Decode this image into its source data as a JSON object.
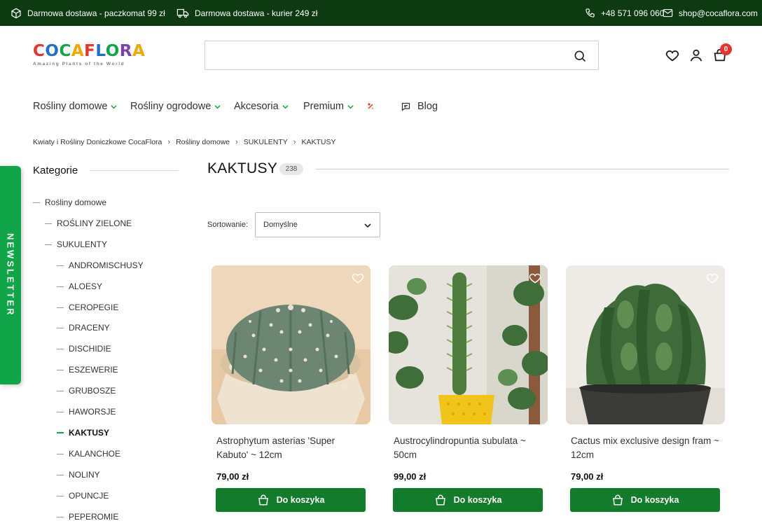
{
  "topbar": {
    "shipping_parcel": "Darmowa dostawa - paczkomat 99 zł",
    "shipping_courier": "Darmowa dostawa - kurier 249 zł",
    "phone": "+48 571 096 060",
    "email": "shop@cocaflora.com",
    "bg_color": "#0e3a12"
  },
  "header": {
    "logo": {
      "letters": [
        {
          "ch": "C",
          "color": "#e8322b"
        },
        {
          "ch": "O",
          "color": "#1a73c8"
        },
        {
          "ch": "C",
          "color": "#0fa548"
        },
        {
          "ch": "A",
          "color": "#f2a900"
        },
        {
          "ch": "F",
          "color": "#e8322b"
        },
        {
          "ch": "L",
          "color": "#1a73c8"
        },
        {
          "ch": "O",
          "color": "#0fa548"
        },
        {
          "ch": "R",
          "color": "#7b3fb3"
        },
        {
          "ch": "A",
          "color": "#f2a900"
        }
      ],
      "tagline": "Amazing Plants of the World"
    },
    "search": {
      "value": "",
      "placeholder": ""
    },
    "cart_count": "0"
  },
  "nav": {
    "items": [
      {
        "label": "Rośliny domowe"
      },
      {
        "label": "Rośliny ogrodowe"
      },
      {
        "label": "Akcesoria"
      },
      {
        "label": "Premium"
      }
    ],
    "blog": "Blog"
  },
  "breadcrumb": [
    "Kwiaty i Rośliny Doniczkowe CocaFlora",
    "Rośliny domowe",
    "SUKULENTY",
    "KAKTUSY"
  ],
  "sidebar": {
    "newsletter": "NEWSLETTER",
    "title": "Kategorie",
    "categories": [
      {
        "label": "Rośliny domowe",
        "level": 0
      },
      {
        "label": "ROŚLINY ZIELONE",
        "level": 1
      },
      {
        "label": "SUKULENTY",
        "level": 1
      },
      {
        "label": "ANDROMISCHUSY",
        "level": 2
      },
      {
        "label": "ALOESY",
        "level": 2
      },
      {
        "label": "CEROPEGIE",
        "level": 2
      },
      {
        "label": "DRACENY",
        "level": 2
      },
      {
        "label": "DISCHIDIE",
        "level": 2
      },
      {
        "label": "ESZEWERIE",
        "level": 2
      },
      {
        "label": "GRUBOSZE",
        "level": 2
      },
      {
        "label": "HAWORSJE",
        "level": 2
      },
      {
        "label": "KAKTUSY",
        "level": 2,
        "active": true
      },
      {
        "label": "KALANCHOE",
        "level": 2
      },
      {
        "label": "NOLINY",
        "level": 2
      },
      {
        "label": "OPUNCJE",
        "level": 2
      },
      {
        "label": "PEPEROMIE",
        "level": 2
      }
    ]
  },
  "main": {
    "title": "KAKTUSY",
    "count": "238",
    "sort_label": "Sortowanie:",
    "sort_value": "Domyślne",
    "products": [
      {
        "name": "Astrophytum asterias 'Super Kabuto' ~ 12cm",
        "price": "79,00 zł",
        "button": "Do koszyka"
      },
      {
        "name": "Austrocylindropuntia subulata ~ 50cm",
        "price": "99,00 zł",
        "button": "Do koszyka"
      },
      {
        "name": "Cactus mix exclusive design fram ~ 12cm",
        "price": "79,00 zł",
        "button": "Do koszyka"
      }
    ]
  },
  "colors": {
    "accent_green": "#0fa548",
    "button_green": "#137b2c",
    "badge_red": "#e8322b"
  }
}
